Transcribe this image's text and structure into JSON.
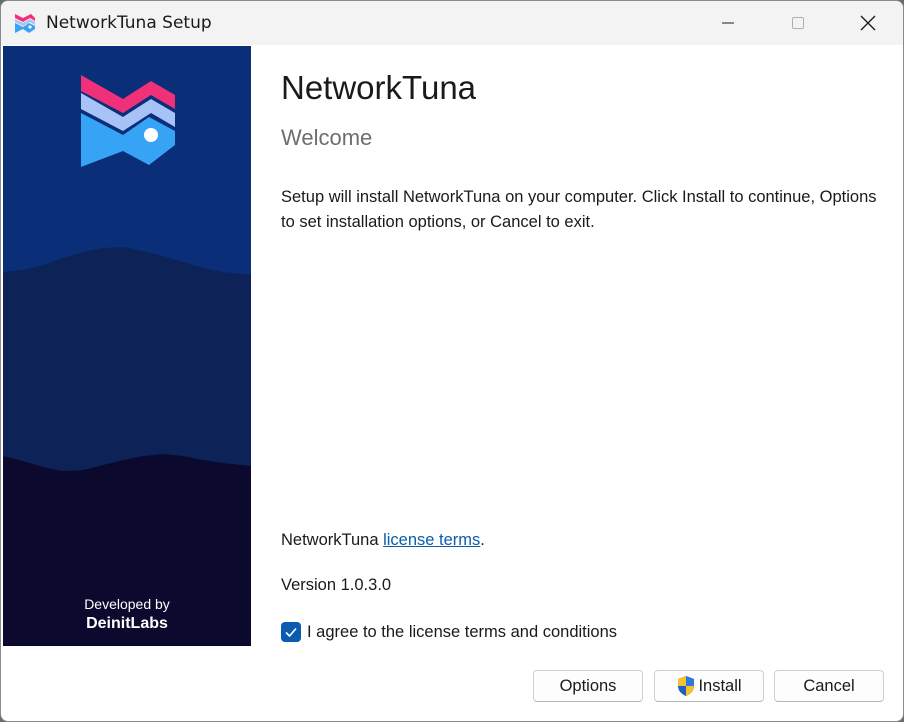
{
  "window": {
    "title": "NetworkTuna Setup"
  },
  "side_panel": {
    "developed_by_label": "Developed by",
    "developer_name": "DeinitLabs"
  },
  "main": {
    "heading": "NetworkTuna",
    "subheading": "Welcome",
    "description": "Setup will install NetworkTuna on your computer. Click Install to continue, Options to set installation options, or Cancel to exit.",
    "license_prefix": "NetworkTuna ",
    "license_link": "license terms",
    "license_suffix": ".",
    "version_text": "Version 1.0.3.0",
    "agree_label": "I agree to the license terms and conditions",
    "agree_checked": true
  },
  "buttons": {
    "options": "Options",
    "install": "Install",
    "cancel": "Cancel"
  },
  "colors": {
    "accent": "#0b5cb0",
    "link": "#0b5cad",
    "panel_top": "#0a2e78",
    "panel_mid": "#0d2358",
    "panel_bottom": "#0b0a2e"
  },
  "icons": {
    "app": "fish-logo-icon",
    "minimize": "minimize-icon",
    "maximize": "maximize-icon",
    "close": "close-icon",
    "uac_shield": "uac-shield-icon",
    "checkmark": "checkmark-icon"
  }
}
